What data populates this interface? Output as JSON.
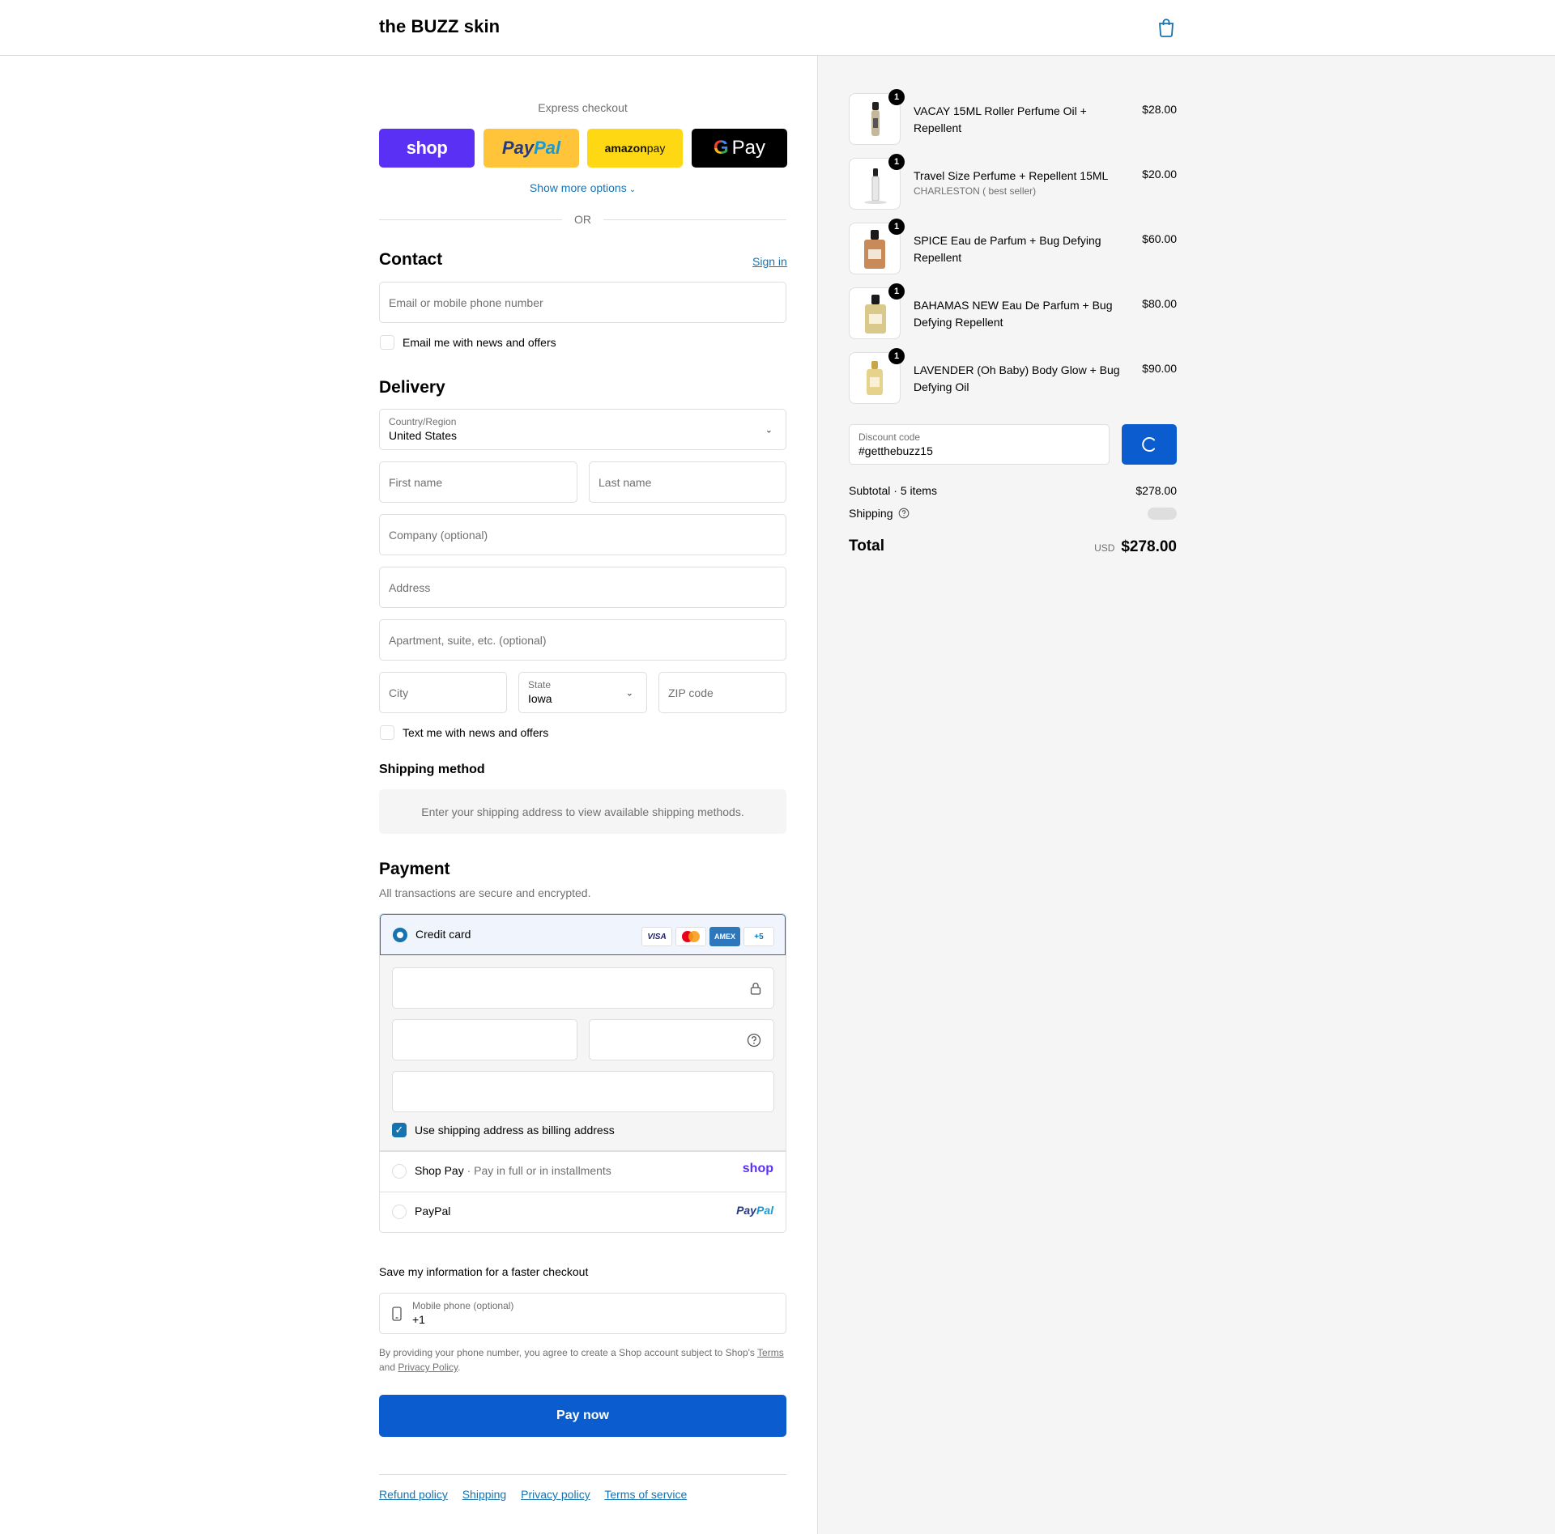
{
  "header": {
    "brand": "the BUZZ skin"
  },
  "express": {
    "label": "Express checkout",
    "shop": "shop",
    "paypal_a": "Pay",
    "paypal_b": "Pal",
    "amazon_a": "amazon",
    "amazon_b": " pay",
    "gpay_g": "G",
    "gpay_text": "Pay",
    "more": "Show more options",
    "or": "OR"
  },
  "contact": {
    "title": "Contact",
    "signin": "Sign in",
    "email_placeholder": "Email or mobile phone number",
    "news_label": "Email me with news and offers"
  },
  "delivery": {
    "title": "Delivery",
    "country_label": "Country/Region",
    "country_value": "United States",
    "first_name": "First name",
    "last_name": "Last name",
    "company": "Company (optional)",
    "address": "Address",
    "apartment": "Apartment, suite, etc. (optional)",
    "city": "City",
    "state_label": "State",
    "state_value": "Iowa",
    "zip": "ZIP code",
    "text_label": "Text me with news and offers"
  },
  "shipping_method": {
    "title": "Shipping method",
    "info": "Enter your shipping address to view available shipping methods."
  },
  "payment": {
    "title": "Payment",
    "subtitle": "All transactions are secure and encrypted.",
    "credit_card": "Credit card",
    "cards": [
      "VISA",
      "",
      "AMEX",
      "+5"
    ],
    "billing_label": "Use shipping address as billing address",
    "shoppay": "Shop Pay",
    "shoppay_sub": "Pay in full or in installments",
    "shoppay_logo": "shop",
    "paypal": "PayPal",
    "paypal_logo_a": "Pay",
    "paypal_logo_b": "Pal"
  },
  "save_info": {
    "title": "Save my information for a faster checkout",
    "phone_label": "Mobile phone (optional)",
    "phone_value": "+1",
    "legal_a": "By providing your phone number, you agree to create a Shop account subject to Shop's ",
    "terms": "Terms",
    "legal_b": "and ",
    "privacy": "Privacy Policy",
    "legal_c": "."
  },
  "pay_now": "Pay now",
  "footer": [
    "Refund policy",
    "Shipping",
    "Privacy policy",
    "Terms of service"
  ],
  "order": {
    "items": [
      {
        "qty": "1",
        "name": "VACAY 15ML Roller Perfume Oil + Repellent",
        "variant": "",
        "price": "$28.00"
      },
      {
        "qty": "1",
        "name": "Travel Size Perfume + Repellent 15ML",
        "variant": "CHARLESTON ( best seller)",
        "price": "$20.00"
      },
      {
        "qty": "1",
        "name": "SPICE Eau de Parfum + Bug Defying Repellent",
        "variant": "",
        "price": "$60.00"
      },
      {
        "qty": "1",
        "name": "BAHAMAS NEW Eau De Parfum + Bug Defying Repellent",
        "variant": "",
        "price": "$80.00"
      },
      {
        "qty": "1",
        "name": "LAVENDER (Oh Baby) Body Glow + Bug Defying Oil",
        "variant": "",
        "price": "$90.00"
      }
    ],
    "discount_label": "Discount code",
    "discount_value": "#getthebuzz15",
    "subtotal_label": "Subtotal · 5 items",
    "subtotal_value": "$278.00",
    "shipping_label": "Shipping",
    "total_label": "Total",
    "currency": "USD",
    "total_value": "$278.00"
  },
  "colors": {
    "accent": "#1773b0",
    "button": "#0b5ccf",
    "shop": "#5a31f4",
    "paypal": "#ffc439",
    "amazon": "#ffd814"
  }
}
